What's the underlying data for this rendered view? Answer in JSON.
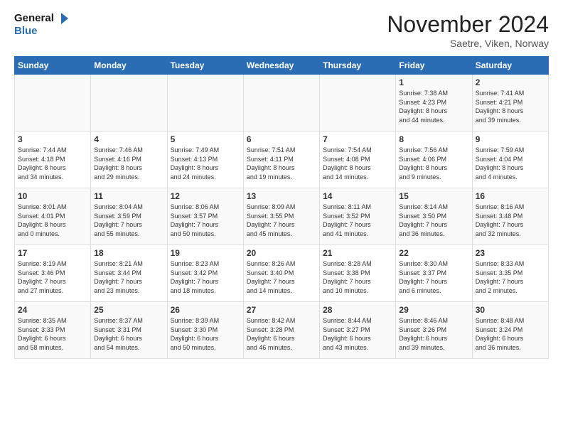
{
  "logo": {
    "line1": "General",
    "line2": "Blue"
  },
  "title": "November 2024",
  "subtitle": "Saetre, Viken, Norway",
  "days_of_week": [
    "Sunday",
    "Monday",
    "Tuesday",
    "Wednesday",
    "Thursday",
    "Friday",
    "Saturday"
  ],
  "weeks": [
    [
      {
        "day": "",
        "info": ""
      },
      {
        "day": "",
        "info": ""
      },
      {
        "day": "",
        "info": ""
      },
      {
        "day": "",
        "info": ""
      },
      {
        "day": "",
        "info": ""
      },
      {
        "day": "1",
        "info": "Sunrise: 7:38 AM\nSunset: 4:23 PM\nDaylight: 8 hours\nand 44 minutes."
      },
      {
        "day": "2",
        "info": "Sunrise: 7:41 AM\nSunset: 4:21 PM\nDaylight: 8 hours\nand 39 minutes."
      }
    ],
    [
      {
        "day": "3",
        "info": "Sunrise: 7:44 AM\nSunset: 4:18 PM\nDaylight: 8 hours\nand 34 minutes."
      },
      {
        "day": "4",
        "info": "Sunrise: 7:46 AM\nSunset: 4:16 PM\nDaylight: 8 hours\nand 29 minutes."
      },
      {
        "day": "5",
        "info": "Sunrise: 7:49 AM\nSunset: 4:13 PM\nDaylight: 8 hours\nand 24 minutes."
      },
      {
        "day": "6",
        "info": "Sunrise: 7:51 AM\nSunset: 4:11 PM\nDaylight: 8 hours\nand 19 minutes."
      },
      {
        "day": "7",
        "info": "Sunrise: 7:54 AM\nSunset: 4:08 PM\nDaylight: 8 hours\nand 14 minutes."
      },
      {
        "day": "8",
        "info": "Sunrise: 7:56 AM\nSunset: 4:06 PM\nDaylight: 8 hours\nand 9 minutes."
      },
      {
        "day": "9",
        "info": "Sunrise: 7:59 AM\nSunset: 4:04 PM\nDaylight: 8 hours\nand 4 minutes."
      }
    ],
    [
      {
        "day": "10",
        "info": "Sunrise: 8:01 AM\nSunset: 4:01 PM\nDaylight: 8 hours\nand 0 minutes."
      },
      {
        "day": "11",
        "info": "Sunrise: 8:04 AM\nSunset: 3:59 PM\nDaylight: 7 hours\nand 55 minutes."
      },
      {
        "day": "12",
        "info": "Sunrise: 8:06 AM\nSunset: 3:57 PM\nDaylight: 7 hours\nand 50 minutes."
      },
      {
        "day": "13",
        "info": "Sunrise: 8:09 AM\nSunset: 3:55 PM\nDaylight: 7 hours\nand 45 minutes."
      },
      {
        "day": "14",
        "info": "Sunrise: 8:11 AM\nSunset: 3:52 PM\nDaylight: 7 hours\nand 41 minutes."
      },
      {
        "day": "15",
        "info": "Sunrise: 8:14 AM\nSunset: 3:50 PM\nDaylight: 7 hours\nand 36 minutes."
      },
      {
        "day": "16",
        "info": "Sunrise: 8:16 AM\nSunset: 3:48 PM\nDaylight: 7 hours\nand 32 minutes."
      }
    ],
    [
      {
        "day": "17",
        "info": "Sunrise: 8:19 AM\nSunset: 3:46 PM\nDaylight: 7 hours\nand 27 minutes."
      },
      {
        "day": "18",
        "info": "Sunrise: 8:21 AM\nSunset: 3:44 PM\nDaylight: 7 hours\nand 23 minutes."
      },
      {
        "day": "19",
        "info": "Sunrise: 8:23 AM\nSunset: 3:42 PM\nDaylight: 7 hours\nand 18 minutes."
      },
      {
        "day": "20",
        "info": "Sunrise: 8:26 AM\nSunset: 3:40 PM\nDaylight: 7 hours\nand 14 minutes."
      },
      {
        "day": "21",
        "info": "Sunrise: 8:28 AM\nSunset: 3:38 PM\nDaylight: 7 hours\nand 10 minutes."
      },
      {
        "day": "22",
        "info": "Sunrise: 8:30 AM\nSunset: 3:37 PM\nDaylight: 7 hours\nand 6 minutes."
      },
      {
        "day": "23",
        "info": "Sunrise: 8:33 AM\nSunset: 3:35 PM\nDaylight: 7 hours\nand 2 minutes."
      }
    ],
    [
      {
        "day": "24",
        "info": "Sunrise: 8:35 AM\nSunset: 3:33 PM\nDaylight: 6 hours\nand 58 minutes."
      },
      {
        "day": "25",
        "info": "Sunrise: 8:37 AM\nSunset: 3:31 PM\nDaylight: 6 hours\nand 54 minutes."
      },
      {
        "day": "26",
        "info": "Sunrise: 8:39 AM\nSunset: 3:30 PM\nDaylight: 6 hours\nand 50 minutes."
      },
      {
        "day": "27",
        "info": "Sunrise: 8:42 AM\nSunset: 3:28 PM\nDaylight: 6 hours\nand 46 minutes."
      },
      {
        "day": "28",
        "info": "Sunrise: 8:44 AM\nSunset: 3:27 PM\nDaylight: 6 hours\nand 43 minutes."
      },
      {
        "day": "29",
        "info": "Sunrise: 8:46 AM\nSunset: 3:26 PM\nDaylight: 6 hours\nand 39 minutes."
      },
      {
        "day": "30",
        "info": "Sunrise: 8:48 AM\nSunset: 3:24 PM\nDaylight: 6 hours\nand 36 minutes."
      }
    ]
  ]
}
